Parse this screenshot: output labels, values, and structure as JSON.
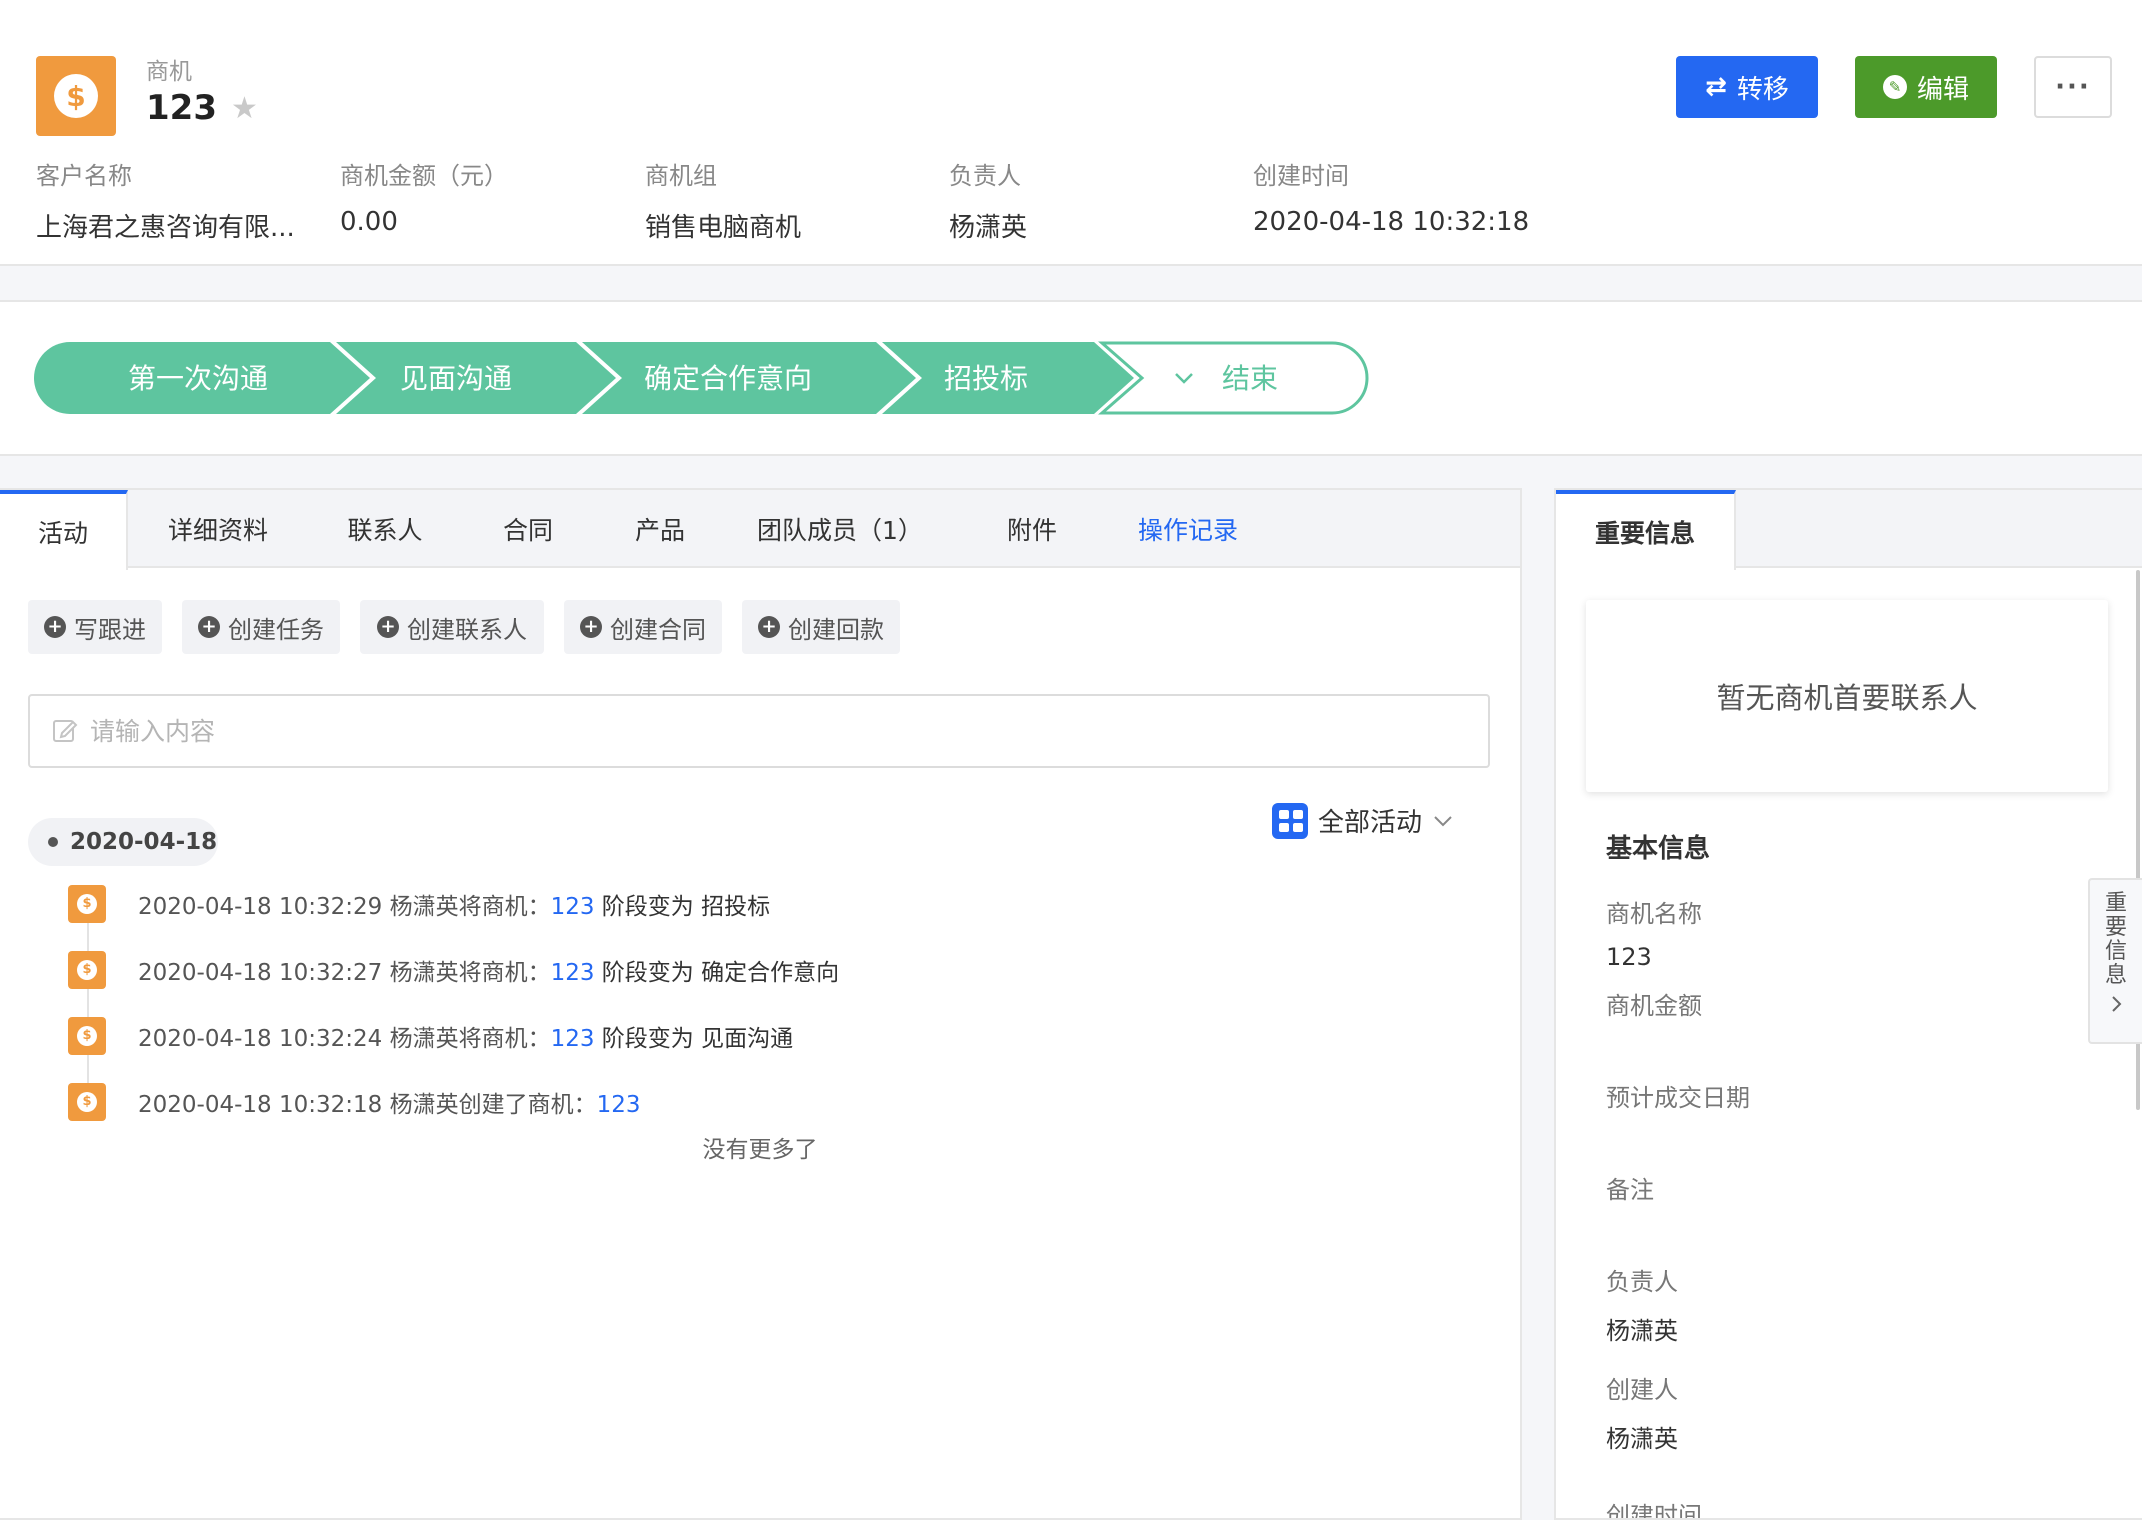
{
  "header": {
    "type_label": "商机",
    "name": "123",
    "transfer_label": "转移",
    "edit_label": "编辑",
    "more_label": "···",
    "fields": [
      {
        "label": "客户名称",
        "value": "上海君之惠咨询有限..."
      },
      {
        "label": "商机金额（元）",
        "value": "0.00"
      },
      {
        "label": "商机组",
        "value": "销售电脑商机"
      },
      {
        "label": "负责人",
        "value": "杨潇英"
      },
      {
        "label": "创建时间",
        "value": "2020-04-18 10:32:18"
      }
    ]
  },
  "stages": [
    {
      "label": "第一次沟通",
      "state": "done"
    },
    {
      "label": "见面沟通",
      "state": "done"
    },
    {
      "label": "确定合作意向",
      "state": "done"
    },
    {
      "label": "招投标",
      "state": "done"
    },
    {
      "label": "结束",
      "state": "pending"
    }
  ],
  "colors": {
    "stage_green": "#5ec59f",
    "primary_blue": "#2468f2",
    "edit_green": "#4c9a2a",
    "icon_orange": "#f09a3e"
  },
  "tabs": [
    {
      "label": "活动",
      "active": true
    },
    {
      "label": "详细资料"
    },
    {
      "label": "联系人"
    },
    {
      "label": "合同"
    },
    {
      "label": "产品"
    },
    {
      "label": "团队成员（1）"
    },
    {
      "label": "附件"
    },
    {
      "label": "操作记录",
      "link": true
    }
  ],
  "actions": [
    "写跟进",
    "创建任务",
    "创建联系人",
    "创建合同",
    "创建回款"
  ],
  "input": {
    "placeholder": "请输入内容"
  },
  "timeline": {
    "date": "2020-04-18",
    "filter_label": "全部活动",
    "items": [
      {
        "prefix": "2020-04-18 10:32:29 杨潇英将商机：",
        "link": "123",
        "suffix": " 阶段变为 ",
        "target": "招投标"
      },
      {
        "prefix": "2020-04-18 10:32:27 杨潇英将商机：",
        "link": "123",
        "suffix": " 阶段变为 ",
        "target": "确定合作意向"
      },
      {
        "prefix": "2020-04-18 10:32:24 杨潇英将商机：",
        "link": "123",
        "suffix": " 阶段变为 ",
        "target": "见面沟通"
      },
      {
        "prefix": "2020-04-18 10:32:18 杨潇英创建了商机：",
        "link": "123",
        "suffix": "",
        "target": ""
      }
    ],
    "no_more": "没有更多了"
  },
  "right": {
    "tab_label": "重要信息",
    "empty_contact": "暂无商机首要联系人",
    "section_title": "基本信息",
    "fields": [
      {
        "label": "商机名称",
        "value": "123"
      },
      {
        "label": "商机金额",
        "value": ""
      },
      {
        "label": "预计成交日期",
        "value": ""
      },
      {
        "label": "备注",
        "value": ""
      },
      {
        "label": "负责人",
        "value": "杨潇英"
      },
      {
        "label": "创建人",
        "value": "杨潇英"
      },
      {
        "label": "创建时间",
        "value": ""
      }
    ],
    "side_tab": [
      "重",
      "要",
      "信",
      "息"
    ]
  }
}
